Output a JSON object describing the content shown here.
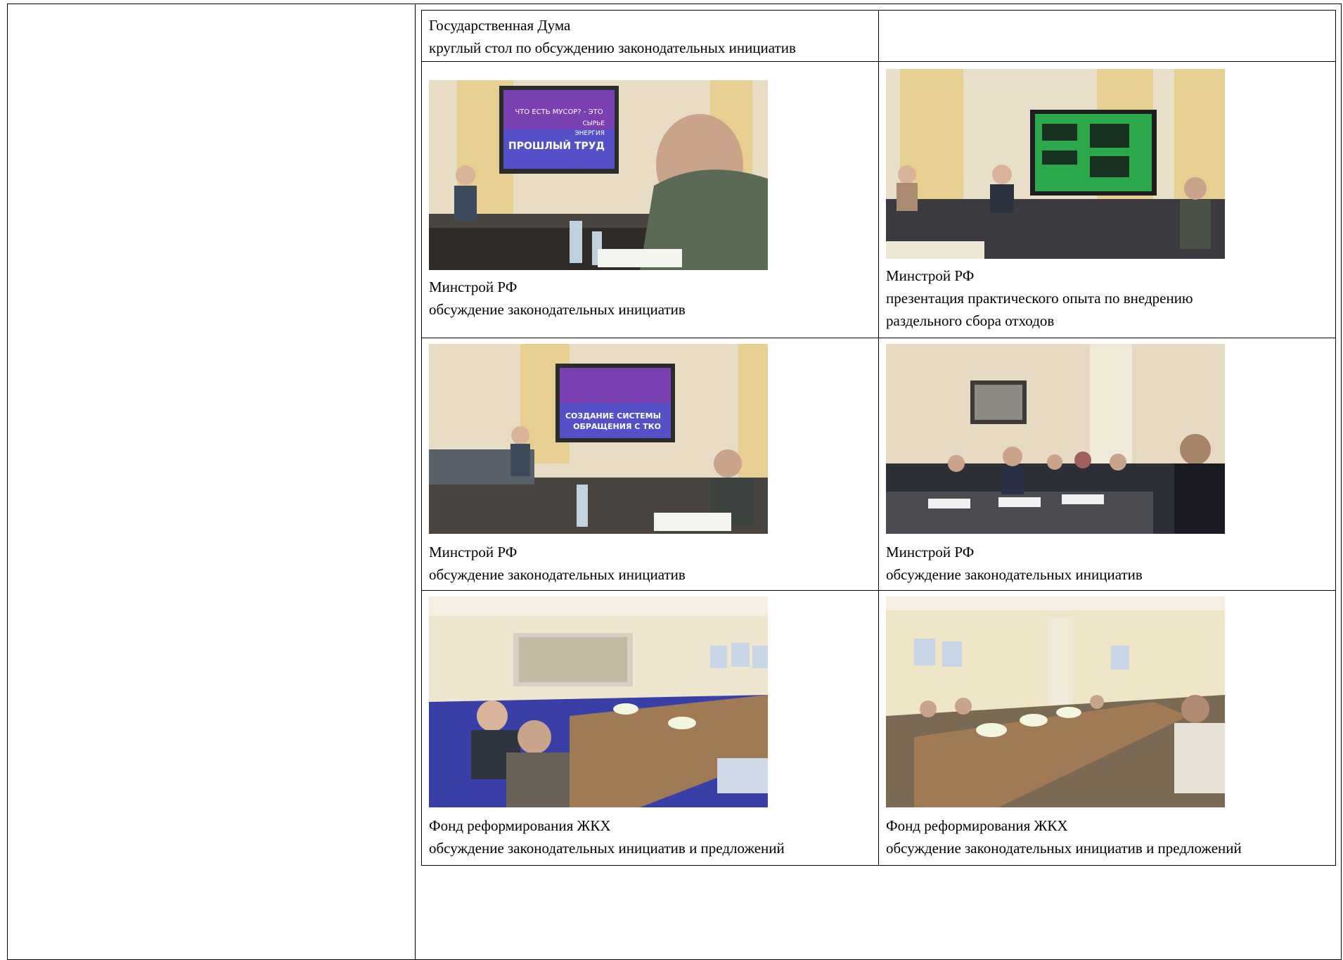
{
  "rows": [
    {
      "left": {
        "org": "Государственная Дума",
        "desc": "круглый стол по обсуждению законодательных инициатив"
      },
      "right": {
        "org": "",
        "desc": ""
      }
    },
    {
      "left": {
        "photo": {
          "screen_text": [
            "ЧТО ЕСТЬ МУСОР? - ЭТО",
            "СЫРЬЕ",
            "ЭНЕРГИЯ",
            "ПРОШЛЫЙ ТРУД"
          ]
        },
        "org": "Минстрой РФ",
        "desc": "обсуждение законодательных инициатив"
      },
      "right": {
        "photo": {
          "screen_text": []
        },
        "org": "Минстрой РФ",
        "desc_line1": "презентация практического опыта по внедрению",
        "desc_line2": "раздельного сбора отходов"
      }
    },
    {
      "left": {
        "photo": {
          "screen_text": [
            "СОЗДАНИЕ СИСТЕМЫ",
            "ОБРАЩЕНИЯ С ТКО"
          ]
        },
        "org": "Минстрой РФ",
        "desc": "обсуждение законодательных инициатив"
      },
      "right": {
        "photo": {
          "screen_text": []
        },
        "org": "Минстрой РФ",
        "desc": "обсуждение законодательных инициатив"
      }
    },
    {
      "left": {
        "photo": {
          "screen_text": []
        },
        "org": "Фонд реформирования ЖКХ",
        "desc": "обсуждение законодательных инициатив и предложений"
      },
      "right": {
        "photo": {
          "screen_text": []
        },
        "org": "Фонд реформирования ЖКХ",
        "desc": "обсуждение законодательных инициатив и предложений"
      }
    }
  ],
  "colors": {
    "wall_beige": "#e8dcc4",
    "curtain": "#e7cf92",
    "screen_purple": "#7a3fb0",
    "screen_green": "#2aa84a",
    "suit_dark": "#3a3f44",
    "table_wood": "#8a6a48",
    "chair_blue": "#3a3fa8"
  }
}
